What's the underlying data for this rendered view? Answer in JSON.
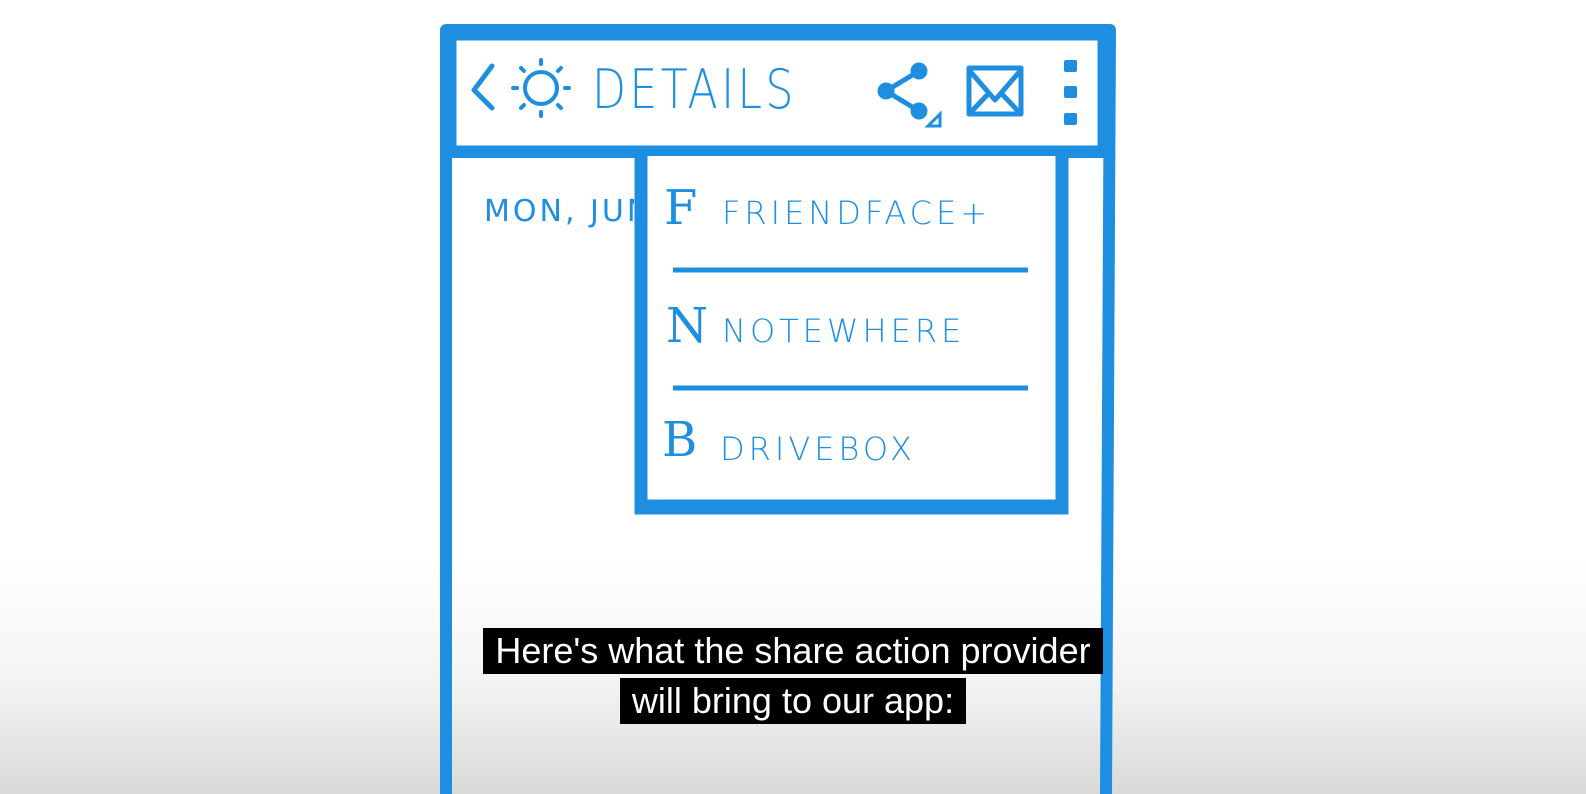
{
  "app_bar": {
    "title": "DETAILS",
    "icons": [
      "back-arrow-icon",
      "sun-icon",
      "share-icon",
      "mail-icon",
      "overflow-menu-icon"
    ]
  },
  "content": {
    "date_text": "MON, JUN"
  },
  "share_menu": {
    "items": [
      {
        "letter": "F",
        "label": "FRIENDFACE+"
      },
      {
        "letter": "N",
        "label": "NOTEWHERE"
      },
      {
        "letter": "B",
        "label": "DRIVEBOX"
      }
    ]
  },
  "caption": {
    "line1": "Here's what the share action provider",
    "line2": "will bring to our app:"
  },
  "colors": {
    "ink": "#1e8fe0",
    "background": "#ffffff",
    "caption_bg": "#000000",
    "caption_text": "#ffffff"
  }
}
